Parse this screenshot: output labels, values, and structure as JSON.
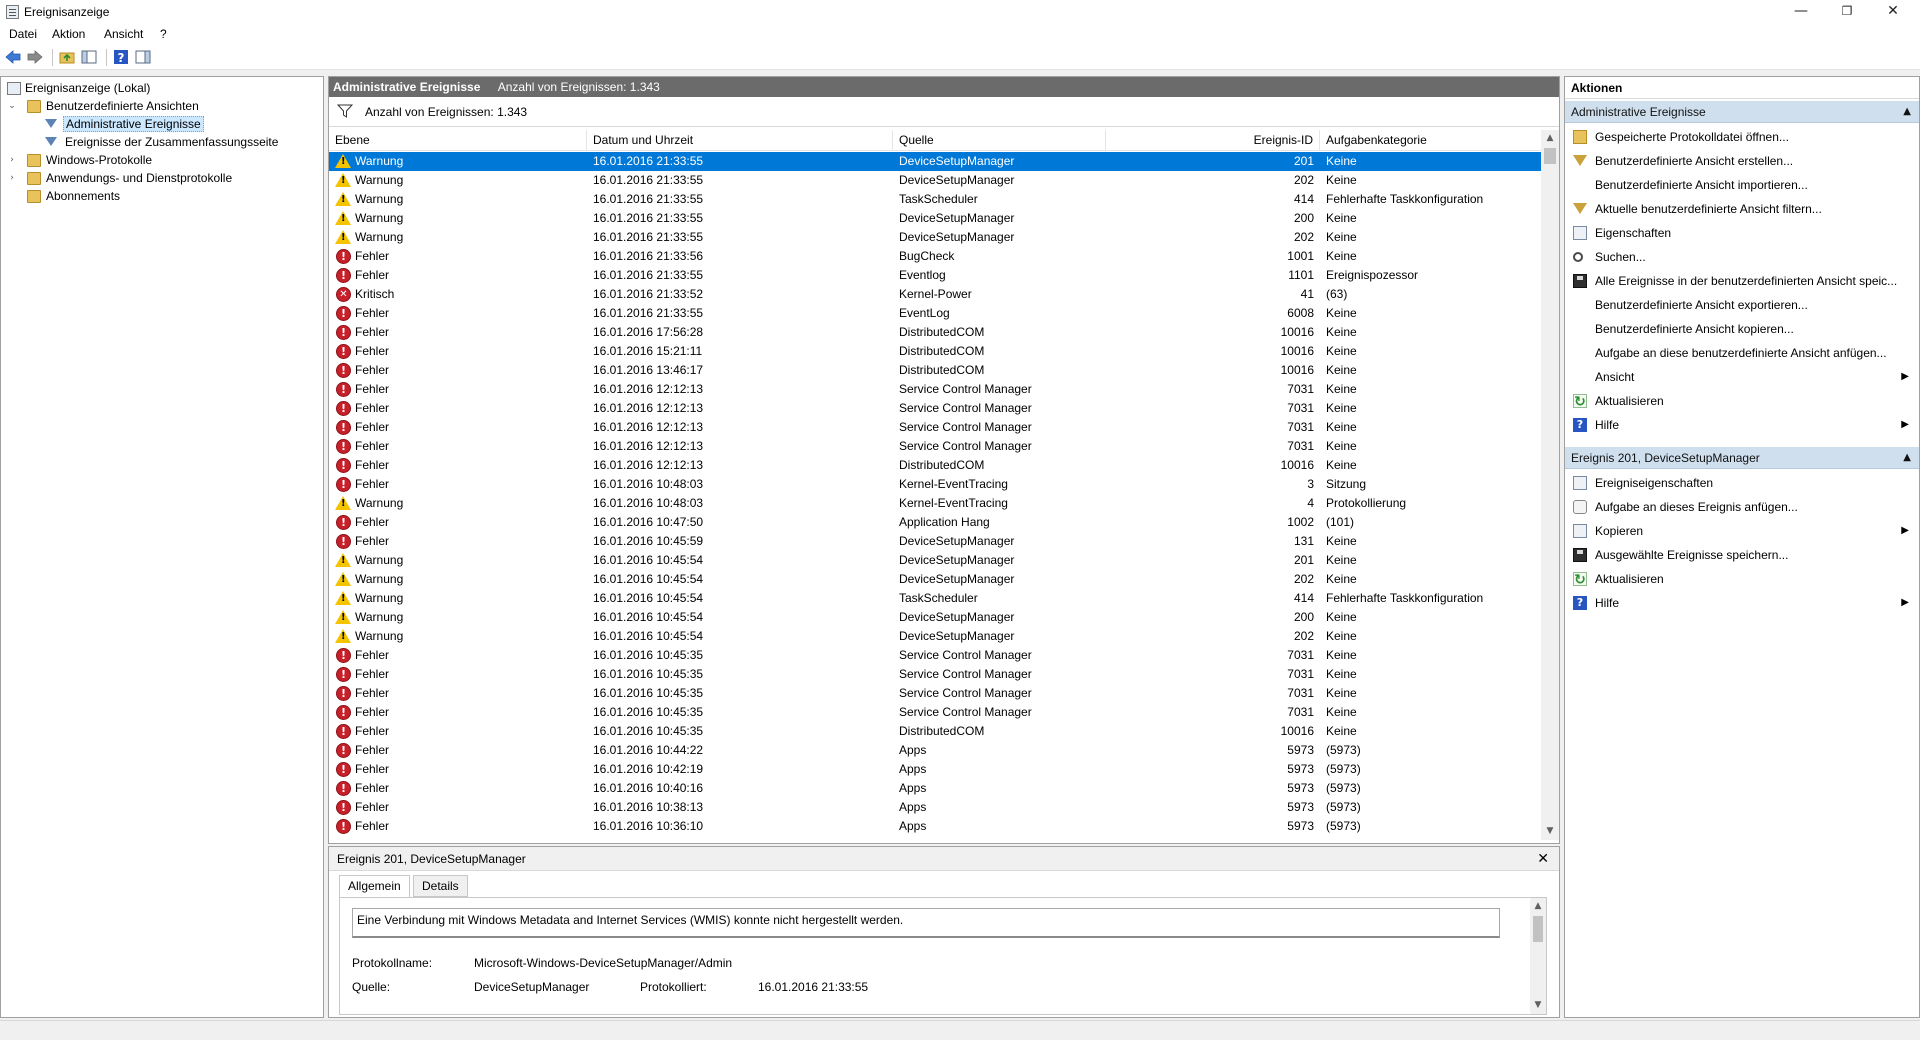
{
  "window": {
    "title": "Ereignisanzeige",
    "controls": {
      "minimize": "—",
      "maximize": "❐",
      "close": "✕"
    }
  },
  "menu": [
    "Datei",
    "Aktion",
    "Ansicht",
    "?"
  ],
  "tree": {
    "root": "Ereignisanzeige (Lokal)",
    "custom_views": "Benutzerdefinierte Ansichten",
    "admin_events": "Administrative Ereignisse",
    "summary_events": "Ereignisse der Zusammenfassungsseite",
    "windows_logs": "Windows-Protokolle",
    "app_service_logs": "Anwendungs- und Dienstprotokolle",
    "subscriptions": "Abonnements"
  },
  "center": {
    "title": "Administrative Ereignisse",
    "count_label": "Anzahl von Ereignissen: 1.343",
    "filter_text": "Anzahl von Ereignissen: 1.343",
    "columns": [
      "Ebene",
      "Datum und Uhrzeit",
      "Quelle",
      "Ereignis-ID",
      "Aufgabenkategorie"
    ],
    "rows": [
      {
        "type": "warn",
        "level": "Warnung",
        "date": "16.01.2016 21:33:55",
        "source": "DeviceSetupManager",
        "id": "201",
        "cat": "Keine"
      },
      {
        "type": "warn",
        "level": "Warnung",
        "date": "16.01.2016 21:33:55",
        "source": "DeviceSetupManager",
        "id": "202",
        "cat": "Keine"
      },
      {
        "type": "warn",
        "level": "Warnung",
        "date": "16.01.2016 21:33:55",
        "source": "TaskScheduler",
        "id": "414",
        "cat": "Fehlerhafte Taskkonfiguration"
      },
      {
        "type": "warn",
        "level": "Warnung",
        "date": "16.01.2016 21:33:55",
        "source": "DeviceSetupManager",
        "id": "200",
        "cat": "Keine"
      },
      {
        "type": "warn",
        "level": "Warnung",
        "date": "16.01.2016 21:33:55",
        "source": "DeviceSetupManager",
        "id": "202",
        "cat": "Keine"
      },
      {
        "type": "err",
        "level": "Fehler",
        "date": "16.01.2016 21:33:56",
        "source": "BugCheck",
        "id": "1001",
        "cat": "Keine"
      },
      {
        "type": "err",
        "level": "Fehler",
        "date": "16.01.2016 21:33:55",
        "source": "Eventlog",
        "id": "1101",
        "cat": "Ereignispozessor"
      },
      {
        "type": "crit",
        "level": "Kritisch",
        "date": "16.01.2016 21:33:52",
        "source": "Kernel-Power",
        "id": "41",
        "cat": "(63)"
      },
      {
        "type": "err",
        "level": "Fehler",
        "date": "16.01.2016 21:33:55",
        "source": "EventLog",
        "id": "6008",
        "cat": "Keine"
      },
      {
        "type": "err",
        "level": "Fehler",
        "date": "16.01.2016 17:56:28",
        "source": "DistributedCOM",
        "id": "10016",
        "cat": "Keine"
      },
      {
        "type": "err",
        "level": "Fehler",
        "date": "16.01.2016 15:21:11",
        "source": "DistributedCOM",
        "id": "10016",
        "cat": "Keine"
      },
      {
        "type": "err",
        "level": "Fehler",
        "date": "16.01.2016 13:46:17",
        "source": "DistributedCOM",
        "id": "10016",
        "cat": "Keine"
      },
      {
        "type": "err",
        "level": "Fehler",
        "date": "16.01.2016 12:12:13",
        "source": "Service Control Manager",
        "id": "7031",
        "cat": "Keine"
      },
      {
        "type": "err",
        "level": "Fehler",
        "date": "16.01.2016 12:12:13",
        "source": "Service Control Manager",
        "id": "7031",
        "cat": "Keine"
      },
      {
        "type": "err",
        "level": "Fehler",
        "date": "16.01.2016 12:12:13",
        "source": "Service Control Manager",
        "id": "7031",
        "cat": "Keine"
      },
      {
        "type": "err",
        "level": "Fehler",
        "date": "16.01.2016 12:12:13",
        "source": "Service Control Manager",
        "id": "7031",
        "cat": "Keine"
      },
      {
        "type": "err",
        "level": "Fehler",
        "date": "16.01.2016 12:12:13",
        "source": "DistributedCOM",
        "id": "10016",
        "cat": "Keine"
      },
      {
        "type": "err",
        "level": "Fehler",
        "date": "16.01.2016 10:48:03",
        "source": "Kernel-EventTracing",
        "id": "3",
        "cat": "Sitzung"
      },
      {
        "type": "warn",
        "level": "Warnung",
        "date": "16.01.2016 10:48:03",
        "source": "Kernel-EventTracing",
        "id": "4",
        "cat": "Protokollierung"
      },
      {
        "type": "err",
        "level": "Fehler",
        "date": "16.01.2016 10:47:50",
        "source": "Application Hang",
        "id": "1002",
        "cat": "(101)"
      },
      {
        "type": "err",
        "level": "Fehler",
        "date": "16.01.2016 10:45:59",
        "source": "DeviceSetupManager",
        "id": "131",
        "cat": "Keine"
      },
      {
        "type": "warn",
        "level": "Warnung",
        "date": "16.01.2016 10:45:54",
        "source": "DeviceSetupManager",
        "id": "201",
        "cat": "Keine"
      },
      {
        "type": "warn",
        "level": "Warnung",
        "date": "16.01.2016 10:45:54",
        "source": "DeviceSetupManager",
        "id": "202",
        "cat": "Keine"
      },
      {
        "type": "warn",
        "level": "Warnung",
        "date": "16.01.2016 10:45:54",
        "source": "TaskScheduler",
        "id": "414",
        "cat": "Fehlerhafte Taskkonfiguration"
      },
      {
        "type": "warn",
        "level": "Warnung",
        "date": "16.01.2016 10:45:54",
        "source": "DeviceSetupManager",
        "id": "200",
        "cat": "Keine"
      },
      {
        "type": "warn",
        "level": "Warnung",
        "date": "16.01.2016 10:45:54",
        "source": "DeviceSetupManager",
        "id": "202",
        "cat": "Keine"
      },
      {
        "type": "err",
        "level": "Fehler",
        "date": "16.01.2016 10:45:35",
        "source": "Service Control Manager",
        "id": "7031",
        "cat": "Keine"
      },
      {
        "type": "err",
        "level": "Fehler",
        "date": "16.01.2016 10:45:35",
        "source": "Service Control Manager",
        "id": "7031",
        "cat": "Keine"
      },
      {
        "type": "err",
        "level": "Fehler",
        "date": "16.01.2016 10:45:35",
        "source": "Service Control Manager",
        "id": "7031",
        "cat": "Keine"
      },
      {
        "type": "err",
        "level": "Fehler",
        "date": "16.01.2016 10:45:35",
        "source": "Service Control Manager",
        "id": "7031",
        "cat": "Keine"
      },
      {
        "type": "err",
        "level": "Fehler",
        "date": "16.01.2016 10:45:35",
        "source": "DistributedCOM",
        "id": "10016",
        "cat": "Keine"
      },
      {
        "type": "err",
        "level": "Fehler",
        "date": "16.01.2016 10:44:22",
        "source": "Apps",
        "id": "5973",
        "cat": "(5973)"
      },
      {
        "type": "err",
        "level": "Fehler",
        "date": "16.01.2016 10:42:19",
        "source": "Apps",
        "id": "5973",
        "cat": "(5973)"
      },
      {
        "type": "err",
        "level": "Fehler",
        "date": "16.01.2016 10:40:16",
        "source": "Apps",
        "id": "5973",
        "cat": "(5973)"
      },
      {
        "type": "err",
        "level": "Fehler",
        "date": "16.01.2016 10:38:13",
        "source": "Apps",
        "id": "5973",
        "cat": "(5973)"
      },
      {
        "type": "err",
        "level": "Fehler",
        "date": "16.01.2016 10:36:10",
        "source": "Apps",
        "id": "5973",
        "cat": "(5973)"
      }
    ]
  },
  "detail": {
    "title": "Ereignis 201, DeviceSetupManager",
    "close": "✕",
    "tabs": [
      "Allgemein",
      "Details"
    ],
    "message": "Eine Verbindung mit Windows Metadata and Internet Services (WMIS) konnte nicht hergestellt werden.",
    "log_name_label": "Protokollname:",
    "log_name_value": "Microsoft-Windows-DeviceSetupManager/Admin",
    "source_label": "Quelle:",
    "source_value": "DeviceSetupManager",
    "logged_label": "Protokolliert:",
    "logged_value": "16.01.2016 21:33:55"
  },
  "actions": {
    "title": "Aktionen",
    "section1": "Administrative Ereignisse",
    "items1": [
      {
        "icon": "open-log-icon",
        "label": "Gespeicherte Protokolldatei öffnen...",
        "sub": false
      },
      {
        "icon": "create-view-icon",
        "label": "Benutzerdefinierte Ansicht erstellen...",
        "sub": false
      },
      {
        "icon": "",
        "label": "Benutzerdefinierte Ansicht importieren...",
        "sub": false
      },
      {
        "icon": "filter-icon",
        "label": "Aktuelle benutzerdefinierte Ansicht filtern...",
        "sub": false
      },
      {
        "icon": "properties-icon",
        "label": "Eigenschaften",
        "sub": false
      },
      {
        "icon": "find-icon",
        "label": "Suchen...",
        "sub": false
      },
      {
        "icon": "save-icon",
        "label": "Alle Ereignisse in der benutzerdefinierten Ansicht speic...",
        "sub": false
      },
      {
        "icon": "",
        "label": "Benutzerdefinierte Ansicht exportieren...",
        "sub": false
      },
      {
        "icon": "",
        "label": "Benutzerdefinierte Ansicht kopieren...",
        "sub": false
      },
      {
        "icon": "",
        "label": "Aufgabe an diese benutzerdefinierte Ansicht anfügen...",
        "sub": false
      },
      {
        "icon": "",
        "label": "Ansicht",
        "sub": true
      },
      {
        "icon": "refresh-icon",
        "label": "Aktualisieren",
        "sub": false
      },
      {
        "icon": "help-icon",
        "label": "Hilfe",
        "sub": true
      }
    ],
    "section2": "Ereignis 201, DeviceSetupManager",
    "items2": [
      {
        "icon": "properties-icon",
        "label": "Ereigniseigenschaften",
        "sub": false
      },
      {
        "icon": "task-icon",
        "label": "Aufgabe an dieses Ereignis anfügen...",
        "sub": false
      },
      {
        "icon": "copy-icon",
        "label": "Kopieren",
        "sub": true
      },
      {
        "icon": "save-icon",
        "label": "Ausgewählte Ereignisse speichern...",
        "sub": false
      },
      {
        "icon": "refresh-icon",
        "label": "Aktualisieren",
        "sub": false
      },
      {
        "icon": "help-icon",
        "label": "Hilfe",
        "sub": true
      }
    ]
  }
}
